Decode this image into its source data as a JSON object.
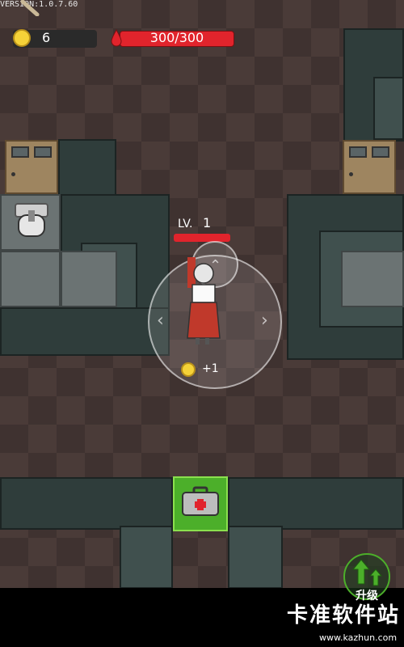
{
  "hud": {
    "version": "VERSION:1.0.7.60",
    "coins": "6",
    "hp": "300/300"
  },
  "player": {
    "level_label": "LV.",
    "level_value": "1",
    "coin_gain": "+1"
  },
  "upgrade": {
    "label": "升级"
  },
  "watermark": {
    "brand": "卡准软件站",
    "url": "www.kazhun.com"
  },
  "colors": {
    "hp_red": "#e1242c",
    "coin_gold": "#f5d238",
    "wall_dark": "#2f3d3b",
    "floor_tile": "#4a3b38",
    "medkit_green": "#4caf2a"
  },
  "icons": {
    "coin": "coin-icon",
    "blood": "blood-drop-icon",
    "medkit": "medkit-icon",
    "upgrade": "upgrade-arrows-icon"
  }
}
